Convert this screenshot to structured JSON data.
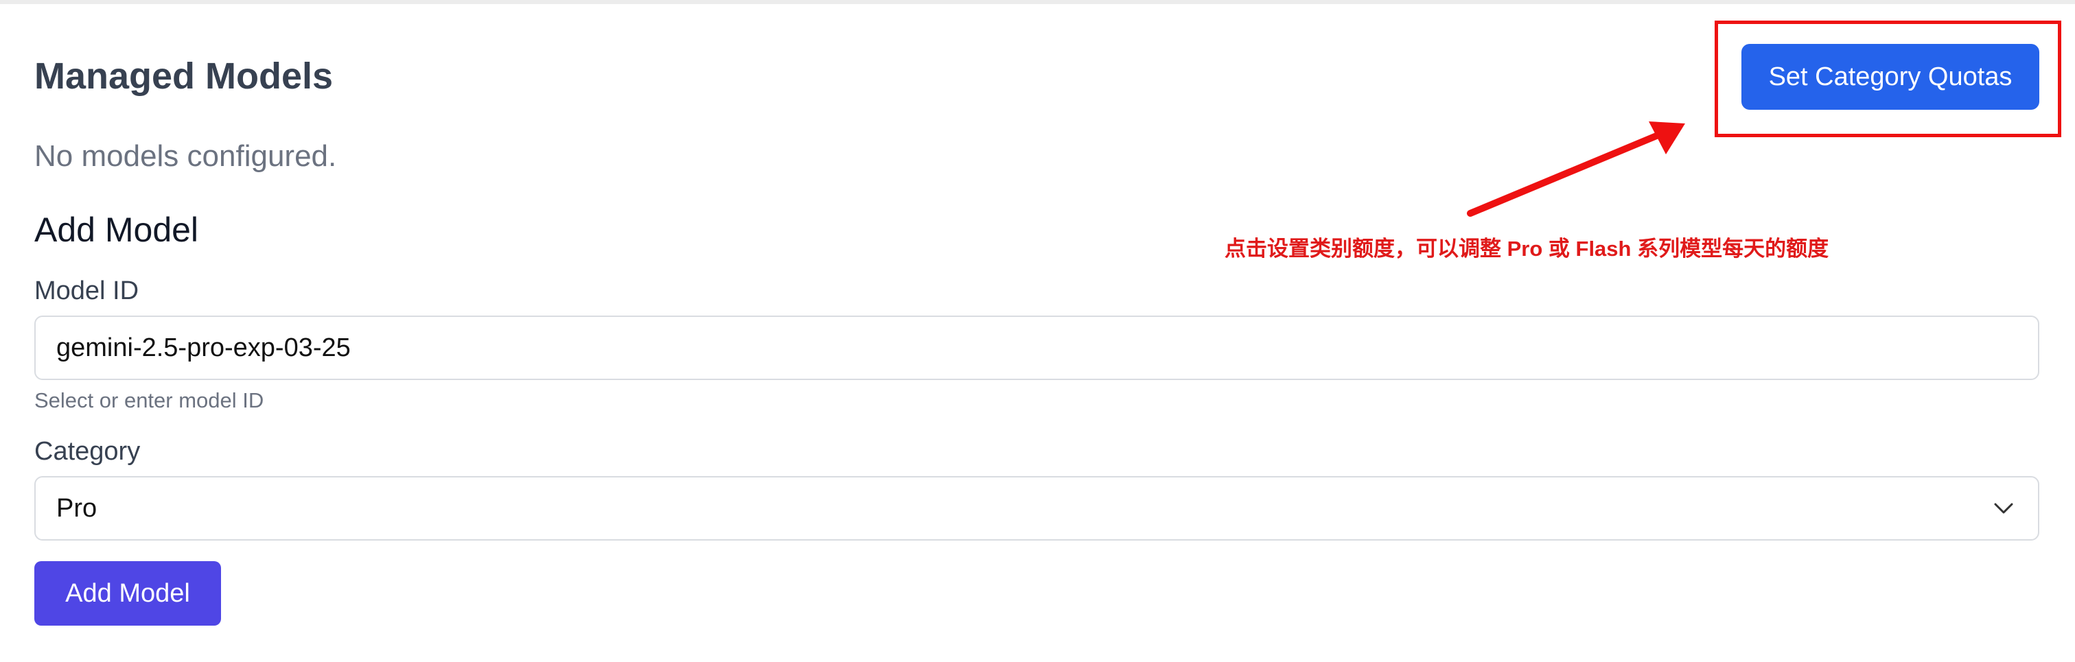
{
  "header": {
    "title": "Managed Models",
    "quota_button_label": "Set Category Quotas"
  },
  "models": {
    "empty_message": "No models configured."
  },
  "add_model": {
    "section_title": "Add Model",
    "model_id_label": "Model ID",
    "model_id_value": "gemini-2.5-pro-exp-03-25",
    "model_id_hint": "Select or enter model ID",
    "category_label": "Category",
    "category_selected": "Pro",
    "submit_label": "Add Model"
  },
  "annotation": {
    "text": "点击设置类别额度，可以调整 Pro 或 Flash 系列模型每天的额度",
    "color": "#e01a1a"
  },
  "colors": {
    "primary_blue": "#2563eb",
    "indigo": "#4f46e5",
    "highlight_red": "#ee1111"
  }
}
